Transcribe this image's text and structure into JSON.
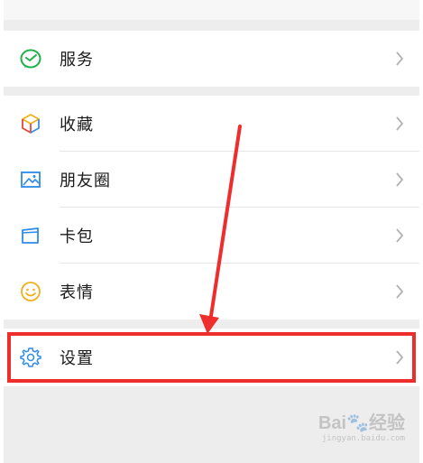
{
  "menu": {
    "group1": [
      {
        "label": "服务",
        "icon": "wechat-pay-icon"
      }
    ],
    "group2": [
      {
        "label": "收藏",
        "icon": "cube-icon"
      },
      {
        "label": "朋友圈",
        "icon": "photo-icon"
      },
      {
        "label": "卡包",
        "icon": "wallet-card-icon"
      },
      {
        "label": "表情",
        "icon": "smiley-icon"
      }
    ],
    "group3": [
      {
        "label": "设置",
        "icon": "gear-icon"
      }
    ]
  },
  "annotation": {
    "highlight_color": "#ee2d2d",
    "arrow_color": "#ee2d2d"
  },
  "watermark": {
    "brand": "Bai",
    "brand_suffix": "经验",
    "url": "jingyan.baidu.com"
  }
}
